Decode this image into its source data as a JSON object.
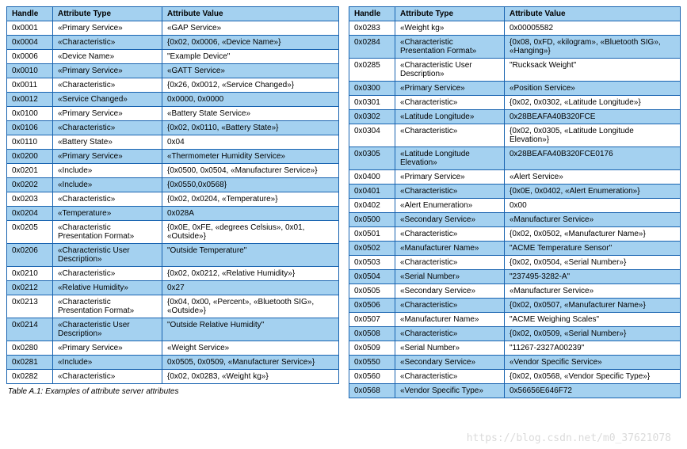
{
  "columns": {
    "handle": "Handle",
    "type": "Attribute Type",
    "value": "Attribute Value"
  },
  "caption": "Table A.1:  Examples of attribute server attributes",
  "watermark": "https://blog.csdn.net/m0_37621078",
  "left": [
    {
      "h": "0x0001",
      "t": "«Primary Service»",
      "v": "«GAP Service»"
    },
    {
      "h": "0x0004",
      "t": "«Characteristic»",
      "v": "{0x02, 0x0006, «Device Name»}"
    },
    {
      "h": "0x0006",
      "t": "«Device Name»",
      "v": "\"Example Device\""
    },
    {
      "h": "0x0010",
      "t": "«Primary Service»",
      "v": "«GATT Service»"
    },
    {
      "h": "0x0011",
      "t": "«Characteristic»",
      "v": "{0x26, 0x0012, «Service Changed»}"
    },
    {
      "h": "0x0012",
      "t": "«Service Changed»",
      "v": "0x0000, 0x0000"
    },
    {
      "h": "0x0100",
      "t": "«Primary Service»",
      "v": "«Battery State Service»"
    },
    {
      "h": "0x0106",
      "t": "«Characteristic»",
      "v": "{0x02, 0x0110, «Battery State»}"
    },
    {
      "h": "0x0110",
      "t": "«Battery State»",
      "v": "0x04"
    },
    {
      "h": "0x0200",
      "t": "«Primary Service»",
      "v": "«Thermometer Humidity Service»"
    },
    {
      "h": "0x0201",
      "t": "«Include»",
      "v": "{0x0500, 0x0504, «Manufacturer Service»}"
    },
    {
      "h": "0x0202",
      "t": "«Include»",
      "v": "{0x0550,0x0568}"
    },
    {
      "h": "0x0203",
      "t": "«Characteristic»",
      "v": "{0x02, 0x0204, «Temperature»}"
    },
    {
      "h": "0x0204",
      "t": "«Temperature»",
      "v": "0x028A"
    },
    {
      "h": "0x0205",
      "t": "«Characteristic Presentation Format»",
      "v": "{0x0E, 0xFE, «degrees Celsius», 0x01, «Outside»}"
    },
    {
      "h": "0x0206",
      "t": "«Characteristic User Description»",
      "v": "\"Outside Temperature\""
    },
    {
      "h": "0x0210",
      "t": "«Characteristic»",
      "v": "{0x02, 0x0212, «Relative Humidity»}"
    },
    {
      "h": "0x0212",
      "t": "«Relative Humidity»",
      "v": "0x27"
    },
    {
      "h": "0x0213",
      "t": "«Characteristic Presentation Format»",
      "v": "{0x04, 0x00, «Percent», «Bluetooth SIG», «Outside»}"
    },
    {
      "h": "0x0214",
      "t": "«Characteristic User Description»",
      "v": "\"Outside Relative Humidity\""
    },
    {
      "h": "0x0280",
      "t": "«Primary Service»",
      "v": "«Weight Service»"
    },
    {
      "h": "0x0281",
      "t": "«Include»",
      "v": "0x0505, 0x0509, «Manufacturer Service»}"
    },
    {
      "h": "0x0282",
      "t": "«Characteristic»",
      "v": "{0x02, 0x0283, «Weight kg»}"
    }
  ],
  "right": [
    {
      "h": "0x0283",
      "t": "«Weight kg»",
      "v": "0x00005582"
    },
    {
      "h": "0x0284",
      "t": "«Characteristic Presentation Format»",
      "v": "{0x08, 0xFD, «kilogram», «Bluetooth SIG», «Hanging»}"
    },
    {
      "h": "0x0285",
      "t": "«Characteristic User Description»",
      "v": "\"Rucksack Weight\""
    },
    {
      "h": "0x0300",
      "t": "«Primary Service»",
      "v": "«Position Service»"
    },
    {
      "h": "0x0301",
      "t": "«Characteristic»",
      "v": "{0x02, 0x0302, «Latitude Longitude»}"
    },
    {
      "h": "0x0302",
      "t": "«Latitude Longitude»",
      "v": "0x28BEAFA40B320FCE"
    },
    {
      "h": "0x0304",
      "t": "«Characteristic»",
      "v": "{0x02, 0x0305, «Latitude Longitude Elevation»}"
    },
    {
      "h": "0x0305",
      "t": "«Latitude Longitude Elevation»",
      "v": "0x28BEAFA40B320FCE0176"
    },
    {
      "h": "0x0400",
      "t": "«Primary Service»",
      "v": "«Alert Service»"
    },
    {
      "h": "0x0401",
      "t": "«Characteristic»",
      "v": "{0x0E, 0x0402, «Alert Enumeration»}"
    },
    {
      "h": "0x0402",
      "t": "«Alert Enumeration»",
      "v": "0x00"
    },
    {
      "h": "0x0500",
      "t": "«Secondary Service»",
      "v": "«Manufacturer Service»"
    },
    {
      "h": "0x0501",
      "t": "«Characteristic»",
      "v": "{0x02, 0x0502, «Manufacturer Name»}"
    },
    {
      "h": "0x0502",
      "t": "«Manufacturer Name»",
      "v": "\"ACME Temperature Sensor\""
    },
    {
      "h": "0x0503",
      "t": "«Characteristic»",
      "v": "{0x02, 0x0504, «Serial Number»}"
    },
    {
      "h": "0x0504",
      "t": "«Serial Number»",
      "v": "\"237495-3282-A\""
    },
    {
      "h": "0x0505",
      "t": "«Secondary Service»",
      "v": "«Manufacturer Service»"
    },
    {
      "h": "0x0506",
      "t": "«Characteristic»",
      "v": "{0x02, 0x0507, «Manufacturer Name»}"
    },
    {
      "h": "0x0507",
      "t": "«Manufacturer Name»",
      "v": "\"ACME Weighing Scales\""
    },
    {
      "h": "0x0508",
      "t": "«Characteristic»",
      "v": "{0x02, 0x0509, «Serial Number»}"
    },
    {
      "h": "0x0509",
      "t": "«Serial Number»",
      "v": "\"11267-2327A00239\""
    },
    {
      "h": "0x0550",
      "t": "«Secondary Service»",
      "v": "«Vendor Specific Service»"
    },
    {
      "h": "0x0560",
      "t": "«Characteristic»",
      "v": "{0x02, 0x0568, «Vendor Specific Type»}"
    },
    {
      "h": "0x0568",
      "t": "«Vendor Specific Type»",
      "v": "0x56656E646F72"
    }
  ]
}
